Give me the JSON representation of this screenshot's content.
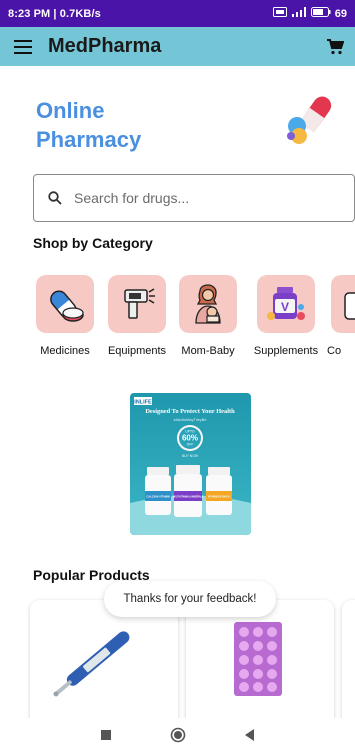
{
  "status_bar": {
    "time": "8:23 PM | 0.7KB/s",
    "battery": "69"
  },
  "app_bar": {
    "title": "MedPharma"
  },
  "hero": {
    "line1": "Online",
    "line2": "Pharmacy"
  },
  "search": {
    "placeholder": "Search for drugs..."
  },
  "categories_section": {
    "title": "Shop by Category",
    "items": [
      {
        "label": "Medicines",
        "icon": "pills-icon"
      },
      {
        "label": "Equipments",
        "icon": "thermometer-gun-icon"
      },
      {
        "label": "Mom-Baby",
        "icon": "mother-baby-icon"
      },
      {
        "label": "Supplements",
        "icon": "vitamins-icon"
      },
      {
        "label": "Co",
        "icon": "cosmetics-icon"
      }
    ]
  },
  "banner": {
    "brand": "INLIFE",
    "headline": "Designed To Protect Your Health",
    "tagline": "#AdultsMayTheyBe",
    "offer_prefix": "UPTO",
    "offer_value": "60%",
    "offer_suffix": "OFF",
    "cta": "BUY NOW",
    "bottles": [
      "CALCIUM VITAMIN",
      "MULTIVITAMIN & MINERALS",
      "VITAMIN D3 5000 IU"
    ]
  },
  "popular_section": {
    "title": "Popular Products"
  },
  "toast": {
    "message": "Thanks for your feedback!"
  },
  "colors": {
    "status_bar": "#4b14a8",
    "app_bar": "#74c6d7",
    "hero_text": "#4a8fe0",
    "category_tile": "#f6c9c4",
    "banner_bg": "#2aa3b8"
  }
}
